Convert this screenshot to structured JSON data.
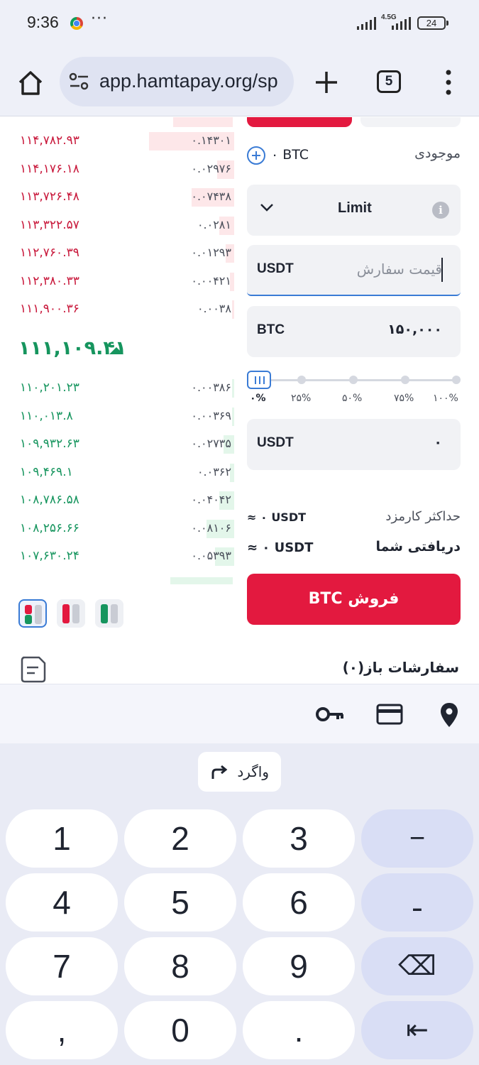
{
  "status_bar": {
    "time": "9:36",
    "dots": "···",
    "network": "4.5G",
    "battery": "24"
  },
  "browser": {
    "url": "app.hamtapay.org/sp",
    "tab_count": "5"
  },
  "order_book": {
    "asks": [
      {
        "price": "۱۱۴,۷۸۲.۹۳",
        "amount": "۰.۱۴۳۰۱",
        "depth": 0.4
      },
      {
        "price": "۱۱۴,۱۷۶.۱۸",
        "amount": "۰.۰۲۹۷۶",
        "depth": 0.08
      },
      {
        "price": "۱۱۳,۷۲۶.۴۸",
        "amount": "۰.۰۷۴۳۸",
        "depth": 0.2
      },
      {
        "price": "۱۱۳,۳۲۲.۵۷",
        "amount": "۰.۰۲۸۱",
        "depth": 0.07
      },
      {
        "price": "۱۱۲,۷۶۰.۳۹",
        "amount": "۰.۰۱۲۹۳",
        "depth": 0.04
      },
      {
        "price": "۱۱۲,۳۸۰.۳۳",
        "amount": "۰.۰۰۴۲۱",
        "depth": 0.02
      },
      {
        "price": "۱۱۱,۹۰۰.۳۶",
        "amount": "۰.۰۰۳۸",
        "depth": 0.01
      }
    ],
    "last_price": "۱۱۱,۱۰۹.۴۱",
    "bids": [
      {
        "price": "۱۱۰,۲۰۱.۲۳",
        "amount": "۰.۰۰۳۸۶",
        "depth": 0.01
      },
      {
        "price": "۱۱۰,۰۱۳.۸",
        "amount": "۰.۰۰۳۶۹",
        "depth": 0.01
      },
      {
        "price": "۱۰۹,۹۳۲.۶۳",
        "amount": "۰.۰۲۷۳۵",
        "depth": 0.05
      },
      {
        "price": "۱۰۹,۴۶۹.۱",
        "amount": "۰.۰۳۶۲",
        "depth": 0.02
      },
      {
        "price": "۱۰۸,۷۸۶.۵۸",
        "amount": "۰.۰۴۰۴۲",
        "depth": 0.07
      },
      {
        "price": "۱۰۸,۲۵۶.۶۶",
        "amount": "۰.۰۸۱۰۶",
        "depth": 0.13
      },
      {
        "price": "۱۰۷,۶۳۰.۲۴",
        "amount": "۰.۰۵۳۹۳",
        "depth": 0.09
      }
    ]
  },
  "trade": {
    "balance_label": "موجودی",
    "balance_value": "۰ BTC",
    "order_type": "Limit",
    "info_icon": "i",
    "price_placeholder": "قیمت سفارش",
    "price_unit": "USDT",
    "amount_unit": "BTC",
    "amount_value": "۱۵۰,۰۰۰",
    "slider_labels": [
      "۰%",
      "۲۵%",
      "۵۰%",
      "۷۵%",
      "۱۰۰%"
    ],
    "slider_value": 0,
    "total_unit": "USDT",
    "total_value": "۰",
    "fee_label": "حداکثر کارمزد",
    "fee_value": "≈ ۰ USDT",
    "receive_label": "دریافتی شما",
    "receive_value": "≈ ۰ USDT",
    "sell_button": "فروش BTC"
  },
  "open_orders": {
    "title": "سفارشات باز(۰)"
  },
  "keyboard": {
    "undo": "واگرد",
    "keys": [
      "1",
      "2",
      "3",
      "−",
      "4",
      "5",
      "6",
      "ـ",
      "7",
      "8",
      "9",
      "⌫",
      ",",
      "0",
      ".",
      "⇤"
    ]
  },
  "colors": {
    "sell": "#e3193f",
    "buy": "#16955e",
    "accent": "#3a7bd5"
  }
}
